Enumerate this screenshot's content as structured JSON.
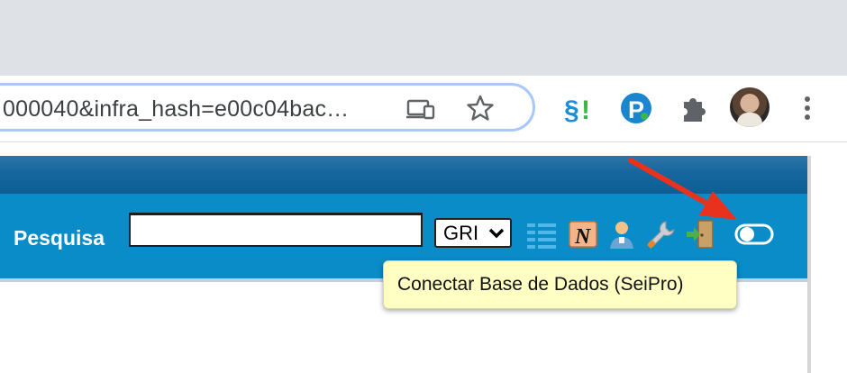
{
  "browser": {
    "url": "000040&infra_hash=e00c04bac…",
    "extensions": [
      {
        "name": "sei-extension-icon",
        "label": "§!"
      },
      {
        "name": "p-extension-icon",
        "label": "P"
      },
      {
        "name": "puzzle-icon",
        "label": ""
      }
    ]
  },
  "nav": {
    "search_label": "Pesquisa",
    "search_value": "",
    "unit_selected": "GRI"
  },
  "tooltip": {
    "text": "Conectar Base de Dados (SeiPro)"
  },
  "colors": {
    "nav_blue": "#0a8cc8",
    "top_band": "#1768a0",
    "tooltip_bg": "#ffffc4",
    "arrow_red": "#e8321e"
  }
}
